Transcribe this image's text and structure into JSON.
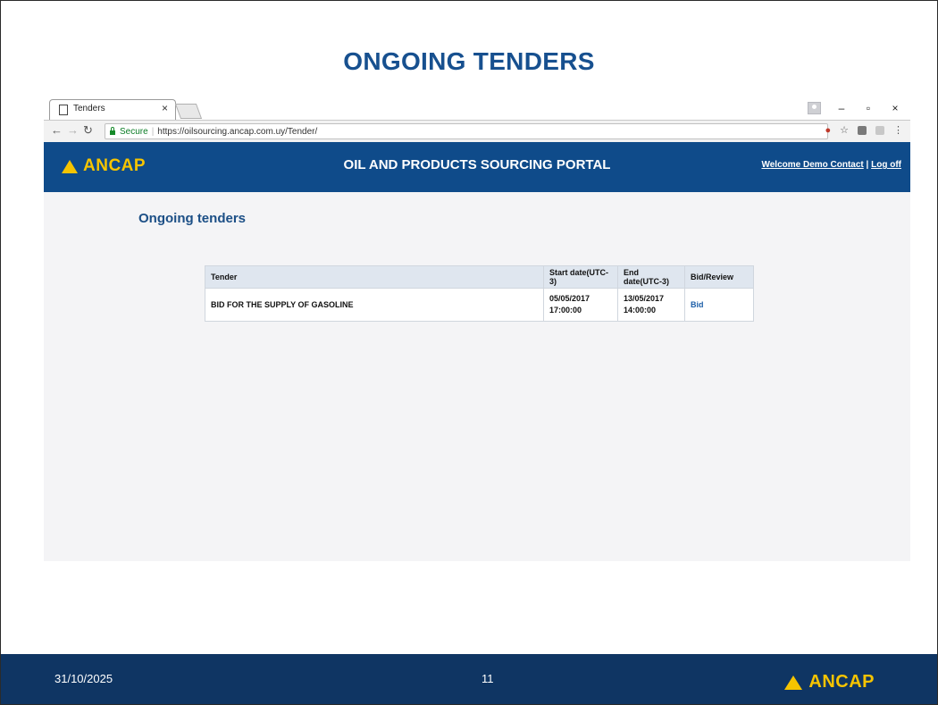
{
  "slide": {
    "title": "ONGOING TENDERS"
  },
  "browser": {
    "tab_title": "Tenders",
    "tab_close": "×",
    "secure_label": "Secure",
    "url": "https://oilsourcing.ancap.com.uy/Tender/",
    "window_controls": [
      "–",
      "▫",
      "×"
    ]
  },
  "site": {
    "logo_text": "ANCAP",
    "portal_title": "OIL AND PRODUCTS SOURCING PORTAL",
    "welcome_link": "Welcome Demo Contact",
    "separator": " | ",
    "logoff_link": "Log off"
  },
  "page": {
    "heading": "Ongoing tenders"
  },
  "table": {
    "headers": [
      "Tender",
      "Start date(UTC-3)",
      "End date(UTC-3)",
      "Bid/Review"
    ],
    "rows": [
      {
        "tender": "BID FOR THE SUPPLY OF GASOLINE",
        "start_date": "05/05/2017",
        "start_time": "17:00:00",
        "end_date": "13/05/2017",
        "end_time": "14:00:00",
        "action": "Bid"
      }
    ]
  },
  "footer": {
    "date": "31/10/2025",
    "page_number": "11",
    "logo_text": "ANCAP"
  },
  "colors": {
    "brand_blue": "#0f4b8a",
    "footer_blue": "#0f3563",
    "logo_yellow": "#f6c400",
    "title_blue": "#17508f"
  }
}
